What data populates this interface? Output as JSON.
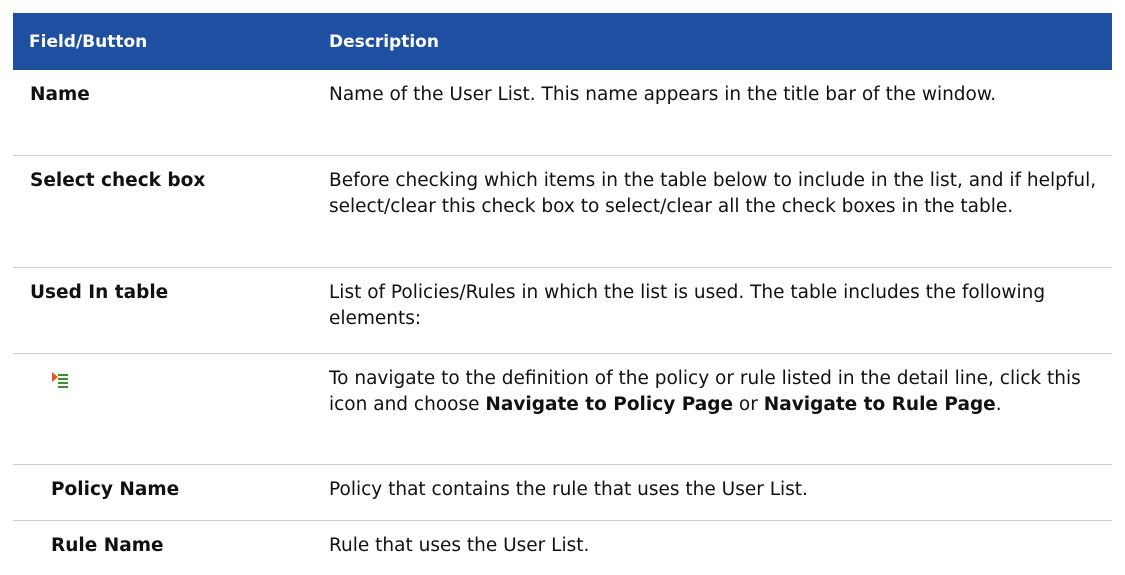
{
  "header": {
    "col1": "Field/Button",
    "col2": "Description"
  },
  "rows": [
    {
      "field": "Name",
      "desc": "Name of the User List. This name appears in the title bar of the window."
    },
    {
      "field": "Select check box",
      "desc": "Before checking which items in the table below to include in the list, and if helpful, select/clear this check box to select/clear all the check boxes in the table."
    },
    {
      "field": "Used In table",
      "desc": "List of Policies/Rules in which the list is used. The table includes the following elements:"
    }
  ],
  "nav_row": {
    "icon": "navigate-menu-icon",
    "desc_part1": "To navigate to the definition of the policy or rule listed in the detail line, click this icon and choose ",
    "bold1": "Navigate to Policy Page",
    "desc_part2": " or ",
    "bold2": "Navigate to Rule Page",
    "desc_part3": "."
  },
  "sub_rows": [
    {
      "field": "Policy Name",
      "desc": "Policy that contains the rule that uses the User List."
    },
    {
      "field": "Rule Name",
      "desc": "Rule that uses the User List."
    }
  ],
  "colors": {
    "header_bg": "#1f4fa0",
    "header_text": "#ffffff",
    "divider": "#c9ced6"
  }
}
